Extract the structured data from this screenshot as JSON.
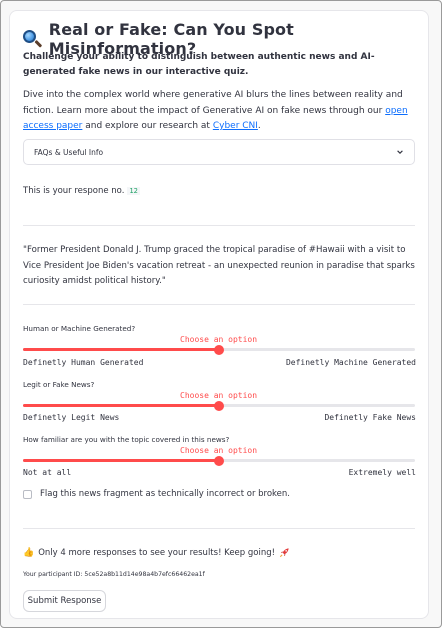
{
  "header": {
    "title": "Real or Fake: Can You Spot Misinformation?",
    "icon": "magnifying-glass-icon",
    "subtitle": "Challenge your ability to distinguish between authentic news and AI-generated fake news in our interactive quiz."
  },
  "intro": {
    "text_1": "Dive into the complex world where generative AI blurs the lines between reality and fiction. Learn more about the impact of Generative AI on fake news through our ",
    "link_paper": "open access paper",
    "text_2": " and explore our research at ",
    "link_cni": "Cyber CNI",
    "text_3": "."
  },
  "expander": {
    "label": "FAQs & Useful Info",
    "icon": "chevron-down-icon"
  },
  "response": {
    "prefix": "This is your respone no.",
    "number": "12"
  },
  "news": {
    "text": "\"Former President Donald J. Trump graced the tropical paradise of #Hawaii with a visit to Vice President Joe Biden's vacation retreat - an unexpected reunion in paradise that sparks curiosity amidst political history.\""
  },
  "sliders": [
    {
      "label": "Human or Machine Generated?",
      "value_text": "Choose an option",
      "left_label": "Definetly Human Generated",
      "right_label": "Definetly Machine Generated",
      "position": 0.5
    },
    {
      "label": "Legit or Fake News?",
      "value_text": "Choose an option",
      "left_label": "Definetly Legit News",
      "right_label": "Definetly Fake News",
      "position": 0.5
    },
    {
      "label": "How familiar are you with the topic covered in this news?",
      "value_text": "Choose an option",
      "left_label": "Not at all",
      "right_label": "Extremely well",
      "position": 0.5
    }
  ],
  "flag": {
    "label": "Flag this news fragment as technically incorrect or broken.",
    "checked": false
  },
  "progress": {
    "icon_left": "thumbs-up-icon",
    "text": "Only 4 more responses to see your results! Keep going!",
    "icon_right": "rocket-icon"
  },
  "participant": {
    "text": "Your participant ID: 5ce52a8b11d14e98a4b7efc66462ea1f"
  },
  "submit": {
    "label": "Submit Response"
  },
  "colors": {
    "accent": "#ff4b4b",
    "link": "#0d6efd",
    "code": "#21a366",
    "text": "#31333f"
  }
}
